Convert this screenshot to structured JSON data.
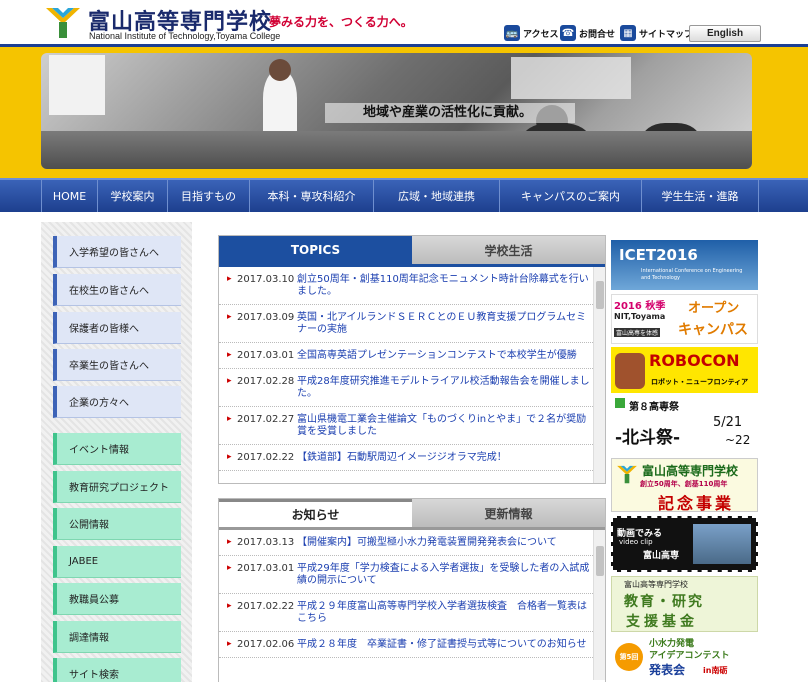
{
  "header": {
    "title_jp": "富山高等専門学校",
    "title_en": "National Institute of Technology,Toyama College",
    "slogan": "夢みる力を、つくる力へ。",
    "util_links": [
      {
        "label": "アクセス",
        "icon": "bus-icon"
      },
      {
        "label": "お問合せ",
        "icon": "phone-icon"
      },
      {
        "label": "サイトマップ",
        "icon": "sitemap-icon"
      }
    ],
    "english_label": "English"
  },
  "hero": {
    "caption": "地域や産業の活性化に貢献。"
  },
  "nav": {
    "items": [
      "HOME",
      "学校案内",
      "目指すもの",
      "本科・専攻科紹介",
      "広域・地域連携",
      "キャンパスのご案内",
      "学生生活・進路"
    ]
  },
  "sidebar": {
    "audience": [
      "入学希望の皆さんへ",
      "在校生の皆さんへ",
      "保護者の皆様へ",
      "卒業生の皆さんへ",
      "企業の方々へ"
    ],
    "links": [
      "イベント情報",
      "教育研究プロジェクト",
      "公開情報",
      "JABEE",
      "教職員公募",
      "調達情報",
      "サイト検索"
    ]
  },
  "topics": {
    "tabs": [
      "TOPICS",
      "学校生活"
    ],
    "items": [
      {
        "date": "2017.03.10",
        "text": "創立50周年・創基110周年記念モニュメント時計台除幕式を行いました。"
      },
      {
        "date": "2017.03.09",
        "text": "英国・北アイルランドＳＥＲＣとのＥＵ教育支援プログラムセミナーの実施"
      },
      {
        "date": "2017.03.01",
        "text": "全国高専英語プレゼンテーションコンテストで本校学生が優勝"
      },
      {
        "date": "2017.02.28",
        "text": "平成28年度研究推進モデルトライアル校活動報告会を開催しました。"
      },
      {
        "date": "2017.02.27",
        "text": "富山県機電工業会主催論文「ものづくりinとやま」で２名が奨励賞を受賞しました"
      },
      {
        "date": "2017.02.22",
        "text": "【鉄道部】石動駅周辺イメージジオラマ完成！"
      }
    ]
  },
  "notices": {
    "tabs": [
      "お知らせ",
      "更新情報"
    ],
    "items": [
      {
        "date": "2017.03.13",
        "text": "【開催案内】可搬型極小水力発電装置開発発表会について"
      },
      {
        "date": "2017.03.01",
        "text": "平成29年度「学力検査による入学者選抜」を受験した者の入試成績の開示について"
      },
      {
        "date": "2017.02.22",
        "text": "平成２９年度富山高等専門学校入学者選抜検査　合格者一覧表はこちら"
      },
      {
        "date": "2017.02.06",
        "text": "平成２８年度　卒業証書・修了証書授与式等についてのお知らせ"
      }
    ]
  },
  "banners": {
    "icet": {
      "title": "ICET2016",
      "sub": "International Conference on Engineering and Technology"
    },
    "open": {
      "line1": "2016 秋季",
      "line2": "NIT,Toyama",
      "line3": "富山高専を体感",
      "big1": "オープン",
      "big2": "キャンパス"
    },
    "robocon": {
      "title": "ROBOCON",
      "sub": "ロボット・ニューフロンティア"
    },
    "hokuto": {
      "line1": "第８高専祭",
      "line2": "-北斗祭-",
      "date1": "5/21",
      "date2": "~22"
    },
    "anniv": {
      "title": "富山高等専門学校",
      "sub": "創立50周年、創基110周年",
      "big": "記念事業"
    },
    "video": {
      "label": "動画でみる",
      "sub": "video clip",
      "name": "富山高専"
    },
    "fund": {
      "school": "富山高等専門学校",
      "line1": "教育・研究",
      "line2": "支援基金"
    },
    "hydro": {
      "badge": "第5回",
      "line1": "小水力発電",
      "line2": "アイデアコンテスト",
      "line3": "発表会",
      "place": "in南砺"
    }
  },
  "colors": {
    "brand_blue": "#1c4fa0",
    "band_yellow": "#f5c400",
    "slogan_red": "#d10034",
    "link_blue": "#1b3fb0"
  }
}
